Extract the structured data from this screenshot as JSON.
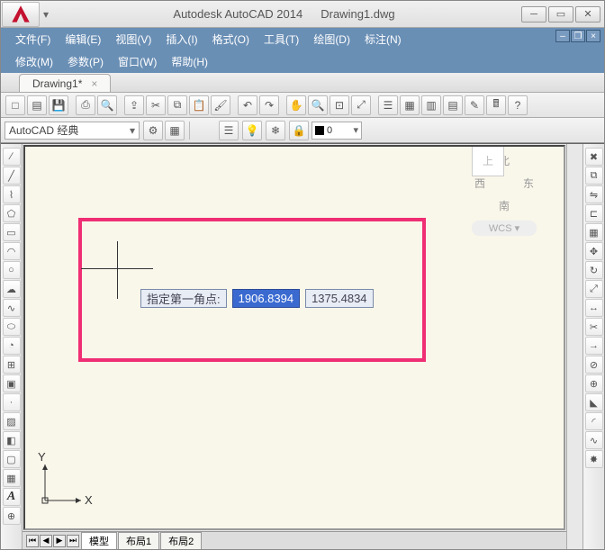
{
  "title": {
    "app": "Autodesk AutoCAD 2014",
    "file": "Drawing1.dwg"
  },
  "menu": {
    "row1": [
      "文件(F)",
      "编辑(E)",
      "视图(V)",
      "插入(I)",
      "格式(O)",
      "工具(T)",
      "绘图(D)",
      "标注(N)"
    ],
    "row2": [
      "修改(M)",
      "参数(P)",
      "窗口(W)",
      "帮助(H)"
    ]
  },
  "doctab": {
    "label": "Drawing1*"
  },
  "workspace": {
    "selected": "AutoCAD 经典"
  },
  "layer": {
    "current": "0"
  },
  "prompt": {
    "label": "指定第一角点:",
    "x": "1906.8394",
    "y": "1375.4834"
  },
  "axes": {
    "x": "X",
    "y": "Y"
  },
  "viewcube": {
    "n": "北",
    "s": "南",
    "e": "东",
    "w": "西",
    "top": "上",
    "wcs": "WCS"
  },
  "modeltabs": {
    "model": "模型",
    "layout1": "布局1",
    "layout2": "布局2"
  }
}
